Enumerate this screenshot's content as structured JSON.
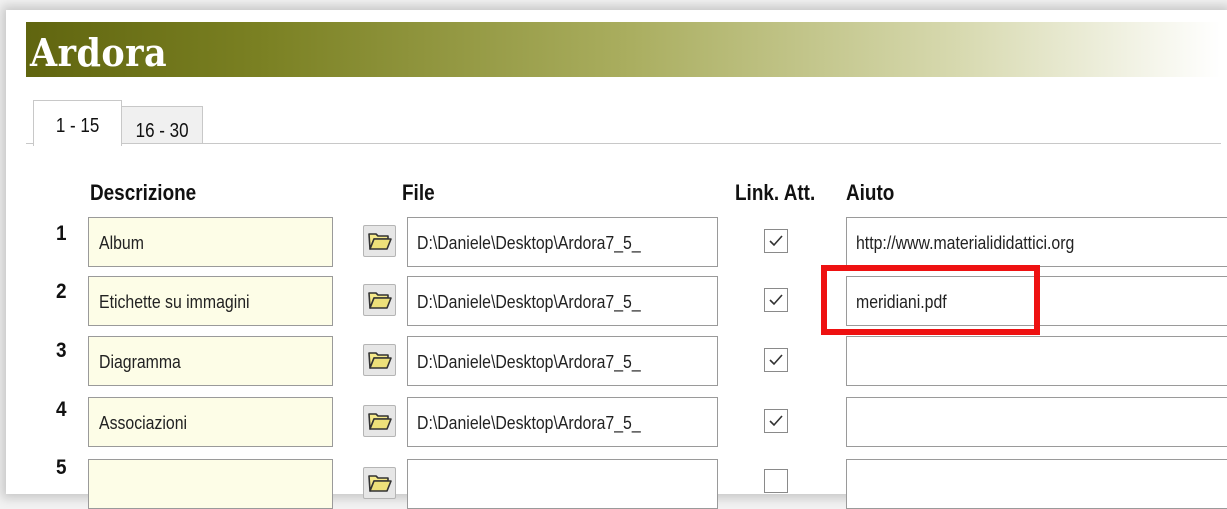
{
  "app": {
    "title": "Ardora"
  },
  "tabs": [
    {
      "label": "1 - 15",
      "active": true
    },
    {
      "label": "16 - 30",
      "active": false
    }
  ],
  "headers": {
    "descrizione": "Descrizione",
    "file": "File",
    "link_att": "Link. Att.",
    "aiuto": "Aiuto"
  },
  "rows": [
    {
      "num": "1",
      "descrizione": "Album",
      "file": "D:\\Daniele\\Desktop\\Ardora7_5_",
      "checked": true,
      "aiuto": "http://www.materialididattici.org"
    },
    {
      "num": "2",
      "descrizione": "Etichette su immagini",
      "file": "D:\\Daniele\\Desktop\\Ardora7_5_",
      "checked": true,
      "aiuto": "meridiani.pdf"
    },
    {
      "num": "3",
      "descrizione": "Diagramma",
      "file": "D:\\Daniele\\Desktop\\Ardora7_5_",
      "checked": true,
      "aiuto": ""
    },
    {
      "num": "4",
      "descrizione": "Associazioni",
      "file": "D:\\Daniele\\Desktop\\Ardora7_5_",
      "checked": true,
      "aiuto": ""
    },
    {
      "num": "5",
      "descrizione": "",
      "file": "",
      "checked": false,
      "aiuto": ""
    }
  ],
  "colors": {
    "title_gradient_start": "#60650f",
    "description_field_bg": "#fdfde7",
    "highlight_border": "#ee1111"
  },
  "icons": {
    "folder_button": "folder-open-icon",
    "checkbox": "checkmark-icon"
  }
}
